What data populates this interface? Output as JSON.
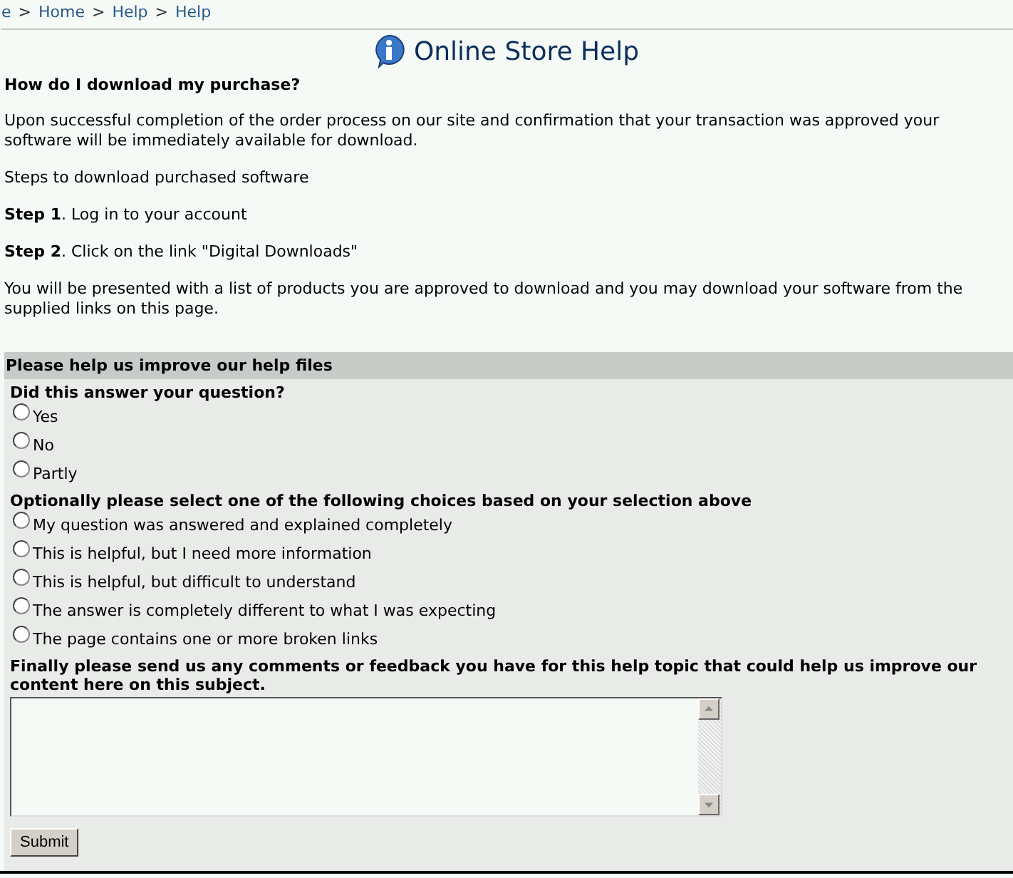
{
  "breadcrumb": {
    "separator": ">",
    "items": [
      "e",
      "Home",
      "Help",
      "Help"
    ]
  },
  "title": "Online Store Help",
  "article": {
    "question": "How do I download my purchase?",
    "paragraphs": [
      "Upon successful completion of the order process on our site and confirmation that your transaction was approved your software will be immediately available for download.",
      "Steps to download purchased software",
      "**Step 1**. Log in to your account",
      "**Step 2**. Click on the link \"Digital Downloads\"",
      "You will be presented with a list of products you are approved to download and you may download your software from the supplied links on this page."
    ]
  },
  "feedback": {
    "heading": "Please help us improve our help files",
    "question": "Did this answer your question?",
    "answers": [
      {
        "label": "Yes",
        "selected": false
      },
      {
        "label": "No",
        "selected": false
      },
      {
        "label": "Partly",
        "selected": false
      }
    ],
    "choices_prompt": "Optionally please select one of the following choices based on your selection above",
    "choices": [
      {
        "label": "My question was answered and explained completely",
        "selected": false
      },
      {
        "label": "This is helpful, but I need more information",
        "selected": false
      },
      {
        "label": "This is helpful, but difficult to understand",
        "selected": false
      },
      {
        "label": "The answer is completely different to what I was expecting",
        "selected": false
      },
      {
        "label": "The page contains one or more broken links",
        "selected": false
      }
    ],
    "comments_prompt": "Finally please send us any comments or feedback you have for this help topic that could help us improve our content here on this subject.",
    "submit": "Submit"
  }
}
